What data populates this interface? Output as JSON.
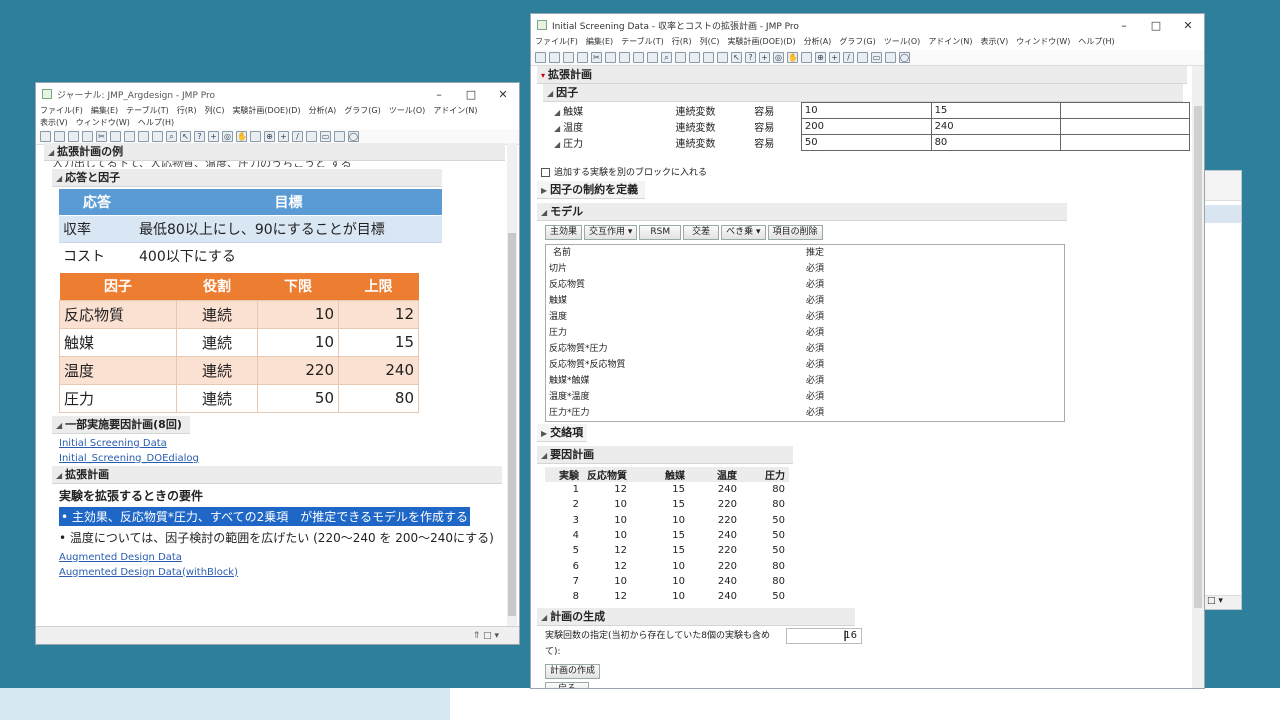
{
  "left_window": {
    "title": "ジャーナル: JMP_Argdesign - JMP Pro",
    "menu": [
      "ファイル(F)",
      "編集(E)",
      "テーブル(T)",
      "行(R)",
      "列(C)",
      "実験計画(DOE)(D)",
      "分析(A)",
      "グラフ(G)",
      "ツール(O)",
      "アドイン(N)",
      "表示(V)",
      "ウィンドウ(W)",
      "ヘルプ(H)"
    ],
    "section_example": "拡張計画の例",
    "cut_text": "入力出してる下て、人応物質、温度、圧力のうちこうと する",
    "section_response": "応答と因子",
    "response_table": {
      "headers": [
        "応答",
        "目標"
      ],
      "rows": [
        [
          "収率",
          "最低80以上にし、90にすることが目標"
        ],
        [
          "コスト",
          "400以下にする"
        ]
      ]
    },
    "factor_table": {
      "headers": [
        "因子",
        "役割",
        "下限",
        "上限"
      ],
      "rows": [
        [
          "反応物質",
          "連続",
          "10",
          "12"
        ],
        [
          "触媒",
          "連続",
          "10",
          "15"
        ],
        [
          "温度",
          "連続",
          "220",
          "240"
        ],
        [
          "圧力",
          "連続",
          "50",
          "80"
        ]
      ]
    },
    "section_fractional": "一部実施要因計画(8回)",
    "links1": [
      "Initial Screening Data",
      "Initial_Screening_DOEdialog"
    ],
    "section_augment": "拡張計画",
    "req_title": "実験を拡張するときの要件",
    "bullet1": "主効果、反応物質*圧力、すべての2乗項　が推定できるモデルを作成する",
    "bullet2": "温度については、因子検討の範囲を広げたい (220～240 を 200～240にする)",
    "links2": [
      "Augmented Design Data",
      "Augmented Design Data(withBlock)"
    ]
  },
  "right_window": {
    "title": "Initial Screening Data - 収率とコストの拡張計画 - JMP Pro",
    "menu": [
      "ファイル(F)",
      "編集(E)",
      "テーブル(T)",
      "行(R)",
      "列(C)",
      "実験計画(DOE)(D)",
      "分析(A)",
      "グラフ(G)",
      "ツール(O)",
      "アドイン(N)",
      "表示(V)",
      "ウィンドウ(W)",
      "ヘルプ(H)"
    ],
    "section_augment": "拡張計画",
    "section_factors": "因子",
    "factors": [
      [
        "触媒",
        "連続変数",
        "容易",
        "10",
        "15"
      ],
      [
        "温度",
        "連続変数",
        "容易",
        "200",
        "240"
      ],
      [
        "圧力",
        "連続変数",
        "容易",
        "50",
        "80"
      ]
    ],
    "block_checkbox": "追加する実験を別のブロックに入れる",
    "section_constraints": "因子の制約を定義",
    "section_model": "モデル",
    "model_buttons": [
      "主効果",
      "交互作用",
      "RSM",
      "交差",
      "べき乗",
      "項目の削除"
    ],
    "model_headers": [
      "名前",
      "推定"
    ],
    "model_terms": [
      [
        "切片",
        "必須"
      ],
      [
        "反応物質",
        "必須"
      ],
      [
        "触媒",
        "必須"
      ],
      [
        "温度",
        "必須"
      ],
      [
        "圧力",
        "必須"
      ],
      [
        "反応物質*圧力",
        "必須"
      ],
      [
        "反応物質*反応物質",
        "必須"
      ],
      [
        "触媒*触媒",
        "必須"
      ],
      [
        "温度*温度",
        "必須"
      ],
      [
        "圧力*圧力",
        "必須"
      ]
    ],
    "section_alias": "交絡項",
    "section_design": "要因計画",
    "design_headers": [
      "実験",
      "反応物質",
      "触媒",
      "温度",
      "圧力"
    ],
    "design_rows": [
      [
        "1",
        "12",
        "15",
        "240",
        "80"
      ],
      [
        "2",
        "10",
        "15",
        "220",
        "80"
      ],
      [
        "3",
        "10",
        "10",
        "220",
        "50"
      ],
      [
        "4",
        "10",
        "15",
        "240",
        "50"
      ],
      [
        "5",
        "12",
        "15",
        "220",
        "50"
      ],
      [
        "6",
        "12",
        "10",
        "220",
        "80"
      ],
      [
        "7",
        "10",
        "10",
        "240",
        "80"
      ],
      [
        "8",
        "12",
        "10",
        "240",
        "50"
      ]
    ],
    "section_generate": "計画の生成",
    "runs_label": "実験回数の指定(当初から存在していた8個の実験も含めて):",
    "runs_value": "16",
    "make_button": "計画の作成",
    "back_button": "戻る"
  },
  "colors": {
    "response_header": "#5b9bd5",
    "factor_header": "#ed7d31",
    "selection": "#1f67c7",
    "desktop": "#2e7f9c"
  }
}
